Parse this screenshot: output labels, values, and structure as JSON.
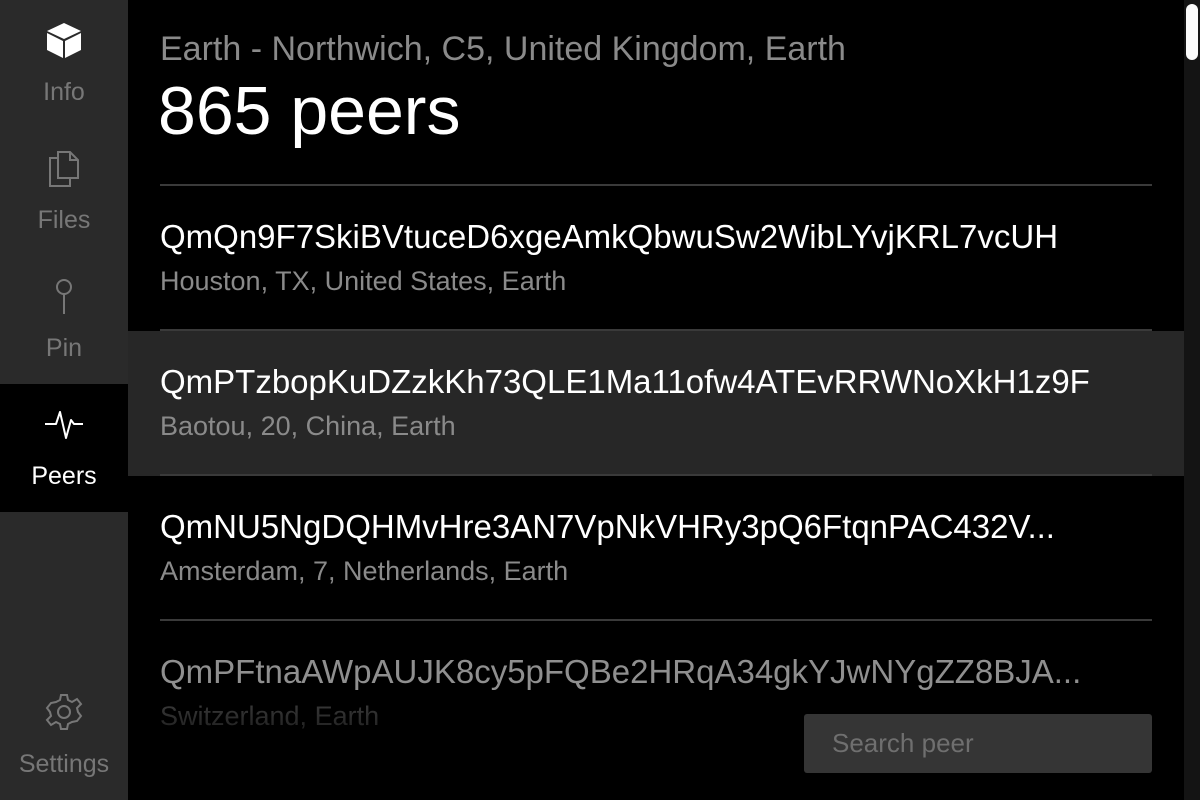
{
  "sidebar": {
    "items": [
      {
        "label": "Info",
        "icon": "cube-icon"
      },
      {
        "label": "Files",
        "icon": "files-icon"
      },
      {
        "label": "Pin",
        "icon": "pin-icon"
      },
      {
        "label": "Peers",
        "icon": "pulse-icon",
        "active": true
      },
      {
        "label": "Settings",
        "icon": "gear-icon"
      }
    ]
  },
  "header": {
    "location": "Earth - Northwich, C5, United Kingdom, Earth",
    "peer_count": "865 peers"
  },
  "peers": [
    {
      "id": "QmQn9F7SkiBVtuceD6xgeAmkQbwuSw2WibLYvjKRL7vcUH",
      "location": "Houston, TX, United States, Earth"
    },
    {
      "id": "QmPTzbopKuDZzkKh73QLE1Ma11ofw4ATEvRRWNoXkH1z9F",
      "location": "Baotou, 20, China, Earth",
      "selected": true
    },
    {
      "id": "QmNU5NgDQHMvHre3AN7VpNkVHRy3pQ6FtqnPAC432V...",
      "location": "Amsterdam, 7, Netherlands, Earth"
    },
    {
      "id": "QmPFtnaAWpAUJK8cy5pFQBe2HRqA34gkYJwNYgZZ8BJA...",
      "location": "Switzerland, Earth"
    }
  ],
  "search": {
    "placeholder": "Search peer",
    "value": ""
  },
  "colors": {
    "sidebar_bg": "#2a2a2a",
    "main_bg": "#000000",
    "selected_row_bg": "#272727",
    "muted_text": "#8a8a8a",
    "search_bg": "#353535"
  }
}
